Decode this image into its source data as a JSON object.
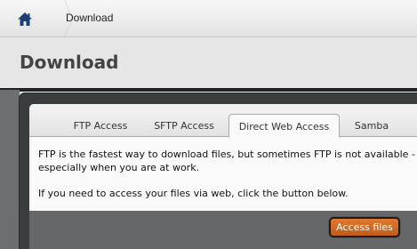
{
  "breadcrumb": {
    "home_icon": "home-icon",
    "current": "Download"
  },
  "page": {
    "title": "Download"
  },
  "tabs": [
    {
      "label": "FTP Access",
      "active": false
    },
    {
      "label": "SFTP Access",
      "active": false
    },
    {
      "label": "Direct Web Access",
      "active": true
    },
    {
      "label": "Samba",
      "active": false
    }
  ],
  "content": {
    "paragraph1": "FTP is the fastest way to download files, but sometimes FTP is not available - especially when you are at work.",
    "paragraph2": "If you need to access your files via web, click the button below."
  },
  "actions": {
    "access_files_label": "Access files"
  },
  "colors": {
    "accent": "#d96a24",
    "frame": "#3a3d3e"
  }
}
